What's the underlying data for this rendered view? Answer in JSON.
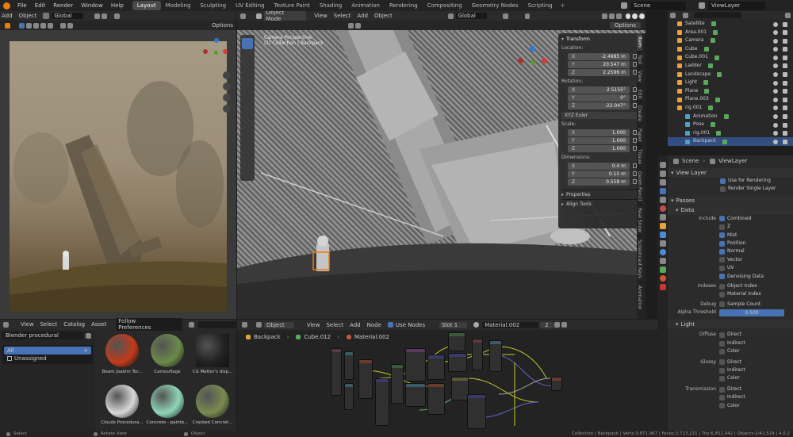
{
  "topbar": {
    "menus": [
      "File",
      "Edit",
      "Render",
      "Window",
      "Help"
    ],
    "workspaces": [
      "Layout",
      "Modeling",
      "Sculpting",
      "UV Editing",
      "Texture Paint",
      "Shading",
      "Animation",
      "Rendering",
      "Compositing",
      "Geometry Nodes",
      "Scripting"
    ],
    "active_workspace": "Layout",
    "scene": "Scene",
    "view_layer": "ViewLayer"
  },
  "left_viewport": {
    "header": {
      "add": "Add",
      "object": "Object",
      "orientation": "Global",
      "options": "Options"
    }
  },
  "main_viewport": {
    "mode": "Object Mode",
    "menus": [
      "View",
      "Select",
      "Add",
      "Object"
    ],
    "orientation": "Global",
    "options": "Options",
    "overlay_title": "Camera Perspective",
    "overlay_sub": "(1) Collection | Backpack"
  },
  "transform_panel": {
    "title": "Transform",
    "location_label": "Location:",
    "location": [
      {
        "axis": "X",
        "value": "-2.4985 m"
      },
      {
        "axis": "Y",
        "value": "20.547 m"
      },
      {
        "axis": "Z",
        "value": "2.2596 m"
      }
    ],
    "rotation_label": "Rotation:",
    "rotation": [
      {
        "axis": "X",
        "value": "2.5155°"
      },
      {
        "axis": "Y",
        "value": "0°"
      },
      {
        "axis": "Z",
        "value": "-22.047°"
      }
    ],
    "rotation_mode": "XYZ Euler",
    "scale_label": "Scale:",
    "scale": [
      {
        "axis": "X",
        "value": "1.000"
      },
      {
        "axis": "Y",
        "value": "1.000"
      },
      {
        "axis": "Z",
        "value": "1.000"
      }
    ],
    "dimensions_label": "Dimensions:",
    "dimensions": [
      {
        "axis": "X",
        "value": "0.4 m"
      },
      {
        "axis": "Y",
        "value": "0.15 m"
      },
      {
        "axis": "Z",
        "value": "0.558 m"
      }
    ],
    "properties": "Properties",
    "align_tools": "Align Tools"
  },
  "npanel_tabs": [
    "Item",
    "Tool",
    "View",
    "Edit",
    "Create",
    "Paper",
    "Tissue",
    "Geom Pencil",
    "Real Snow",
    "Screencast Keys",
    "Animation"
  ],
  "outliner": {
    "items": [
      {
        "name": "Satellite",
        "indent": 0
      },
      {
        "name": "Area.001",
        "indent": 0
      },
      {
        "name": "Camera",
        "indent": 0
      },
      {
        "name": "Cube",
        "indent": 0
      },
      {
        "name": "Cube.001",
        "indent": 0
      },
      {
        "name": "Ladder",
        "indent": 0
      },
      {
        "name": "Landscape",
        "indent": 0
      },
      {
        "name": "Light",
        "indent": 0
      },
      {
        "name": "Plane",
        "indent": 0
      },
      {
        "name": "Plane.003",
        "indent": 0
      },
      {
        "name": "rig.001",
        "indent": 0
      },
      {
        "name": "Animation",
        "indent": 1
      },
      {
        "name": "Pose",
        "indent": 1
      },
      {
        "name": "rig.001",
        "indent": 1
      },
      {
        "name": "Backpack",
        "indent": 1
      }
    ],
    "selected": "Backpack"
  },
  "properties": {
    "scene": "Scene",
    "view_layer": "ViewLayer",
    "view_layer_section": "View Layer",
    "use_for_rendering": "Use for Rendering",
    "render_single_layer": "Render Single Layer",
    "passes": "Passes",
    "data": "Data",
    "include_label": "Include",
    "include": [
      {
        "label": "Combined",
        "on": true
      },
      {
        "label": "Z",
        "on": false
      },
      {
        "label": "Mist",
        "on": true
      },
      {
        "label": "Position",
        "on": true
      },
      {
        "label": "Normal",
        "on": true
      },
      {
        "label": "Vector",
        "on": false
      },
      {
        "label": "UV",
        "on": false
      },
      {
        "label": "Denoising Data",
        "on": true
      }
    ],
    "indexes_label": "Indexes",
    "indexes": [
      "Object Index",
      "Material Index"
    ],
    "debug_label": "Debug",
    "debug": "Sample Count",
    "alpha_label": "Alpha Threshold",
    "alpha_value": "0.500",
    "light": "Light",
    "diffuse_label": "Diffuse",
    "glossy_label": "Glossy",
    "transmission_label": "Transmission",
    "sub": [
      "Direct",
      "Indirect",
      "Color"
    ]
  },
  "asset_browser": {
    "menus": [
      "View",
      "Select",
      "Catalog",
      "Asset"
    ],
    "prefs": "Follow Preferences",
    "library": "Blender procedural",
    "catalogs": [
      "All",
      "Unassigned"
    ],
    "assets": [
      {
        "name": "Beam Joakim Tor...",
        "color": "#c13b1a"
      },
      {
        "name": "Camouflage",
        "color": "#6b8a4a"
      },
      {
        "name": "CG Matter's disp...",
        "color": "#222222"
      },
      {
        "name": "Clouds Procedura...",
        "color": "#d8d8d8"
      },
      {
        "name": "Concrete - painte...",
        "color": "#8fd6b8"
      },
      {
        "name": "Cracked Concret...",
        "color": "#7a8a50"
      }
    ]
  },
  "node_editor": {
    "header": {
      "object": "Object",
      "menus": [
        "View",
        "Select",
        "Add",
        "Node"
      ],
      "use_nodes": "Use Nodes",
      "slot": "Slot 1",
      "material": "Material.002",
      "users": "2"
    },
    "breadcrumb": [
      "Backpack",
      "Cube.012",
      "Material.002"
    ]
  },
  "statusbar": {
    "left": "Select",
    "mid": "Rotate View",
    "mid2": "Object",
    "right": "Collection | Backpack | Verts:3,871,967 | Faces:3,713,221 | Tris:6,851,042 | Objects:1/42,529 | 4.0.2"
  },
  "colors": {
    "accent": "#4772b3",
    "bg": "#1d1d1d",
    "panel": "#2b2b2b",
    "field": "#545454"
  }
}
